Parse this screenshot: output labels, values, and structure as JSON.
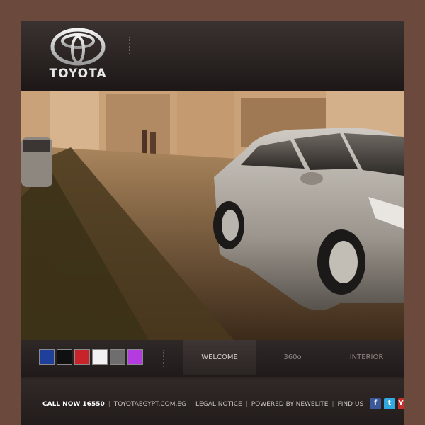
{
  "header": {
    "logo_text": "TOYOTA"
  },
  "color_swatches": [
    {
      "name": "blue",
      "color": "#1e3f9a"
    },
    {
      "name": "black",
      "color": "#101010"
    },
    {
      "name": "red",
      "color": "#c8222a"
    },
    {
      "name": "white",
      "color": "#f2f2f2"
    },
    {
      "name": "grey",
      "color": "#6e6e6e"
    },
    {
      "name": "purple",
      "color": "#b33be0"
    }
  ],
  "tabs": [
    {
      "label": "WELCOME",
      "active": true
    },
    {
      "label": "360o",
      "active": false
    },
    {
      "label": "INTERIOR",
      "active": false
    }
  ],
  "footer": {
    "call": "CALL NOW 16550",
    "site": "TOYOTAEGYPT.COM.EG",
    "legal": "LEGAL NOTICE",
    "powered": "POWERED BY NEWELITE",
    "find": "FIND US"
  },
  "social": [
    {
      "name": "facebook-icon",
      "glyph": "f",
      "color": "#3b5998"
    },
    {
      "name": "twitter-icon",
      "glyph": "t",
      "color": "#33a8e0"
    },
    {
      "name": "youtube-icon",
      "glyph": "Y",
      "color": "#c4302b"
    }
  ]
}
